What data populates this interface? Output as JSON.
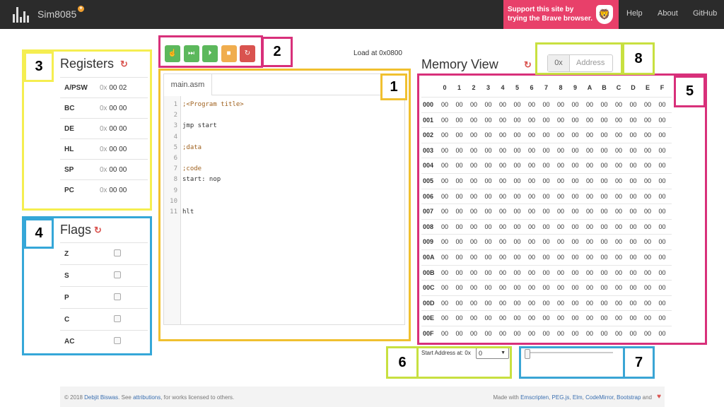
{
  "header": {
    "brand": "Sim8085",
    "badge": "★",
    "promo_line1": "Support this site by",
    "promo_line2": "trying the Brave browser.",
    "nav": [
      "Help",
      "About",
      "GitHub"
    ]
  },
  "callouts": [
    "1",
    "2",
    "3",
    "4",
    "5",
    "6",
    "7",
    "8"
  ],
  "controls": {
    "load_at": "Load at 0x0800",
    "buttons": [
      {
        "name": "assemble-button",
        "glyph": "☝",
        "color": "#5cb85c"
      },
      {
        "name": "run-all-button",
        "glyph": "⏭",
        "color": "#5cb85c"
      },
      {
        "name": "step-button",
        "glyph": "⏵",
        "color": "#5cb85c"
      },
      {
        "name": "stop-button",
        "glyph": "■",
        "color": "#f0ad4e"
      },
      {
        "name": "reset-button",
        "glyph": "↻",
        "color": "#d9534f"
      }
    ]
  },
  "registers": {
    "title": "Registers",
    "refresh": "↻",
    "rows": [
      {
        "name": "A/PSW",
        "prefix": "0x",
        "value": "00 02"
      },
      {
        "name": "BC",
        "prefix": "0x",
        "value": "00 00"
      },
      {
        "name": "DE",
        "prefix": "0x",
        "value": "00 00"
      },
      {
        "name": "HL",
        "prefix": "0x",
        "value": "00 00"
      },
      {
        "name": "SP",
        "prefix": "0x",
        "value": "00 00"
      },
      {
        "name": "PC",
        "prefix": "0x",
        "value": "00 00"
      }
    ]
  },
  "flags": {
    "title": "Flags",
    "refresh": "↻",
    "rows": [
      {
        "name": "Z",
        "checked": false
      },
      {
        "name": "S",
        "checked": false
      },
      {
        "name": "P",
        "checked": false
      },
      {
        "name": "C",
        "checked": false
      },
      {
        "name": "AC",
        "checked": false
      }
    ]
  },
  "editor": {
    "tab": "main.asm",
    "lines": [
      {
        "n": "1",
        "text": ";<Program title>",
        "comment": true
      },
      {
        "n": "2",
        "text": "",
        "comment": false
      },
      {
        "n": "3",
        "text": "jmp start",
        "comment": false
      },
      {
        "n": "4",
        "text": "",
        "comment": false
      },
      {
        "n": "5",
        "text": ";data",
        "comment": true
      },
      {
        "n": "6",
        "text": "",
        "comment": false
      },
      {
        "n": "7",
        "text": ";code",
        "comment": true
      },
      {
        "n": "8",
        "text": "start: nop",
        "comment": false
      },
      {
        "n": "9",
        "text": "",
        "comment": false
      },
      {
        "n": "10",
        "text": "",
        "comment": false
      },
      {
        "n": "11",
        "text": "hlt",
        "comment": false
      }
    ]
  },
  "memory": {
    "title": "Memory View",
    "refresh": "↻",
    "address_prefix": "0x",
    "address_placeholder": "Address",
    "columns": [
      "0",
      "1",
      "2",
      "3",
      "4",
      "5",
      "6",
      "7",
      "8",
      "9",
      "A",
      "B",
      "C",
      "D",
      "E",
      "F"
    ],
    "rows": [
      "000",
      "001",
      "002",
      "003",
      "004",
      "005",
      "006",
      "007",
      "008",
      "009",
      "00A",
      "00B",
      "00C",
      "00D",
      "00E",
      "00F"
    ],
    "cell_value": "00",
    "start_label": "Start Address at: 0x",
    "start_value": "0",
    "start_arrow": "▼"
  },
  "footer": {
    "left_pre": "© 2018",
    "author": "Debjit Biswas",
    "left_mid": ". See",
    "attributions": "attributions",
    "left_post": ", for works licensed to others.",
    "made_with": "Made with",
    "tools": [
      "Emscripten",
      "PEG.js",
      "Elm",
      "CodeMirror",
      "Bootstrap"
    ],
    "and": "and",
    "heart": "♥"
  }
}
